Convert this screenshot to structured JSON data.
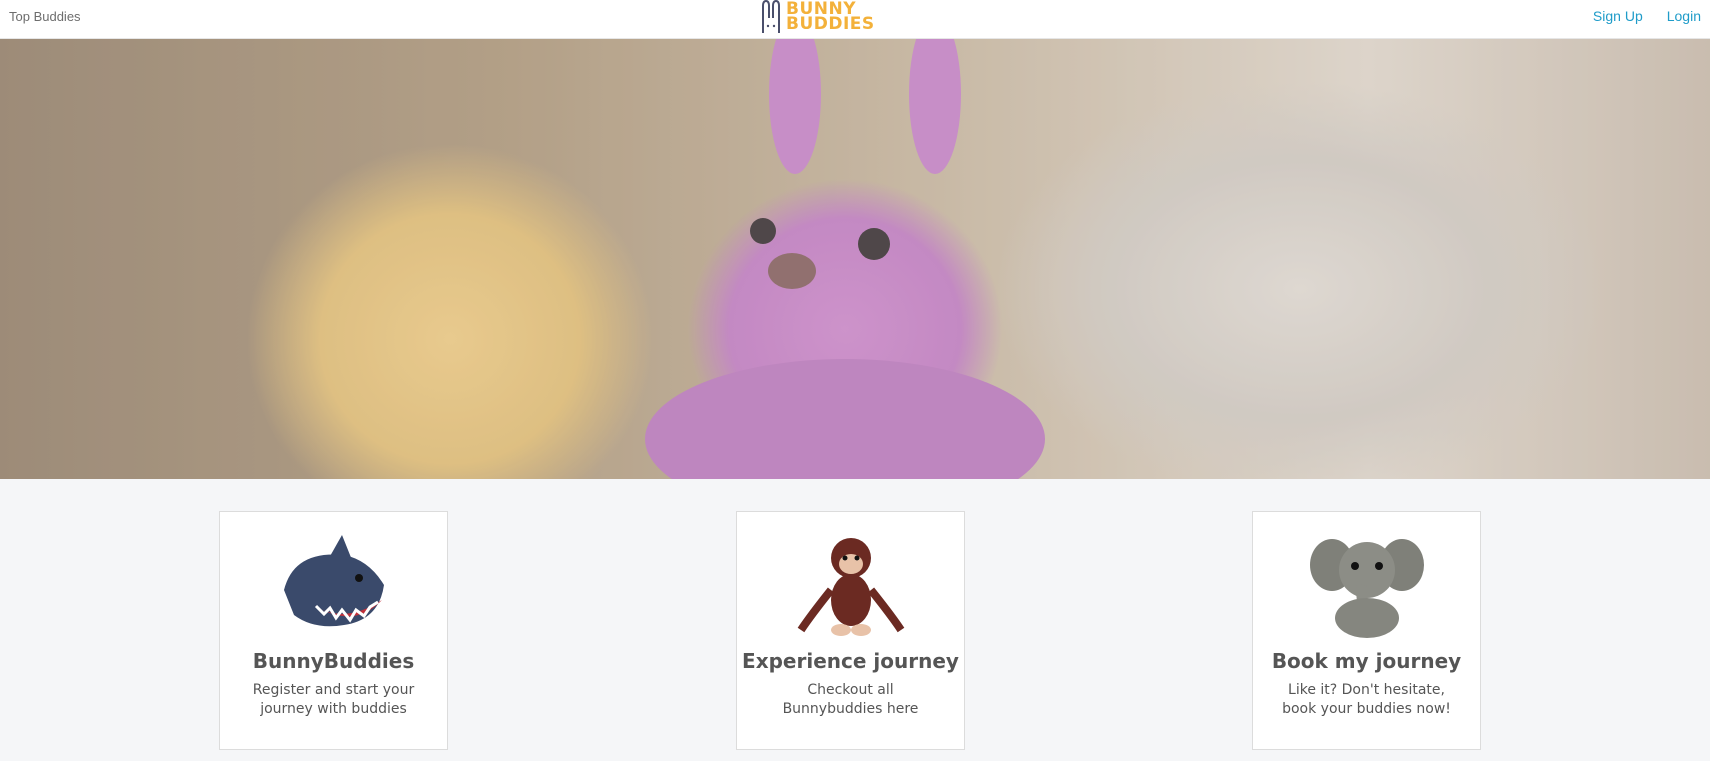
{
  "header": {
    "brand_link": "Top Buddies",
    "logo_line1": "BUNNY",
    "logo_line2": "BUDDIES",
    "signup": "Sign Up",
    "login": "Login"
  },
  "hero": {
    "image": "purple-plush-bunny-photo"
  },
  "cards": [
    {
      "title": "BunnyBuddies",
      "desc": "Register and start your journey with buddies",
      "icon": "shark-plush-icon"
    },
    {
      "title": "Experience journey",
      "desc": "Checkout all Bunnybuddies here",
      "icon": "monkey-plush-icon"
    },
    {
      "title": "Book my journey",
      "desc": "Like it? Don't hesitate, book your buddies now!",
      "icon": "elephant-plush-icon"
    }
  ],
  "colors": {
    "accent": "#1f9cc9",
    "logo": "#f3b13a",
    "background": "#f5f6f8"
  }
}
